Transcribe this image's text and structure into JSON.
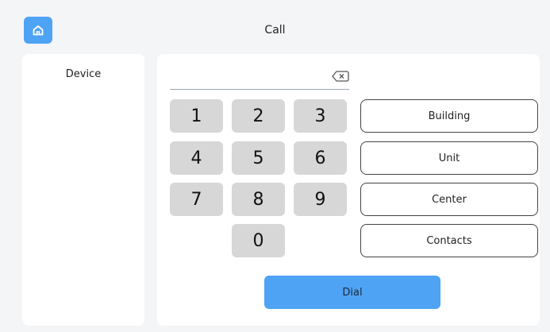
{
  "header": {
    "title": "Call",
    "home_icon": "home-icon"
  },
  "sidebar": {
    "items": [
      {
        "label": "Device"
      }
    ]
  },
  "dialer": {
    "input_value": "",
    "backspace_icon": "backspace-icon",
    "keys": [
      "1",
      "2",
      "3",
      "4",
      "5",
      "6",
      "7",
      "8",
      "9",
      "0"
    ]
  },
  "options": {
    "building_label": "Building",
    "unit_label": "Unit",
    "center_label": "Center",
    "contacts_label": "Contacts"
  },
  "actions": {
    "dial_label": "Dial"
  },
  "colors": {
    "accent": "#4fa3f5",
    "key_bg": "#d7d7d7",
    "page_bg": "#f4f5f7",
    "panel_bg": "#ffffff"
  }
}
